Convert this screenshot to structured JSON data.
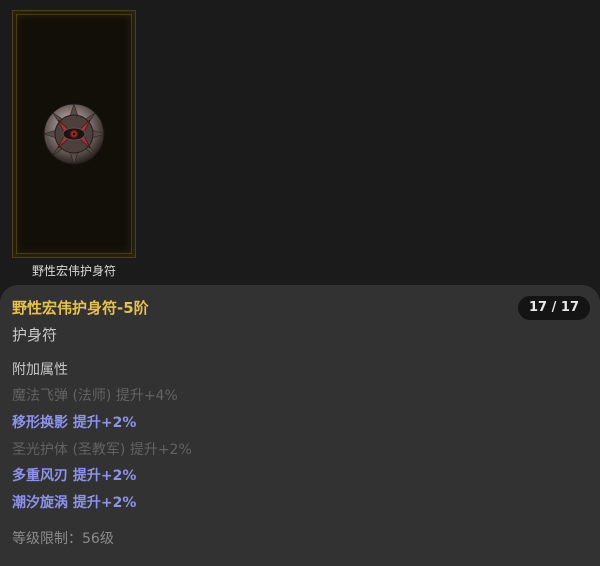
{
  "card": {
    "caption": "野性宏伟护身符",
    "icon": "amulet-icon"
  },
  "tooltip": {
    "item_name": "野性宏伟护身符-5阶",
    "count": "17 / 17",
    "item_type": "护身符",
    "section_header": "附加属性",
    "attributes": [
      {
        "text": "魔法飞弹 (法师) 提升+4%",
        "active": false
      },
      {
        "text": "移形换影 提升+2%",
        "active": true
      },
      {
        "text": "圣光护体 (圣教军) 提升+2%",
        "active": false
      },
      {
        "text": "多重风刃 提升+2%",
        "active": true
      },
      {
        "text": "潮汐旋涡 提升+2%",
        "active": true
      }
    ],
    "level_requirement": "等级限制：56级"
  },
  "colors": {
    "item_name": "#e6c04f",
    "active_attribute": "#8d92ec",
    "inactive_attribute": "#626262",
    "panel_bg": "#323232",
    "page_bg": "#1b1b1b"
  }
}
